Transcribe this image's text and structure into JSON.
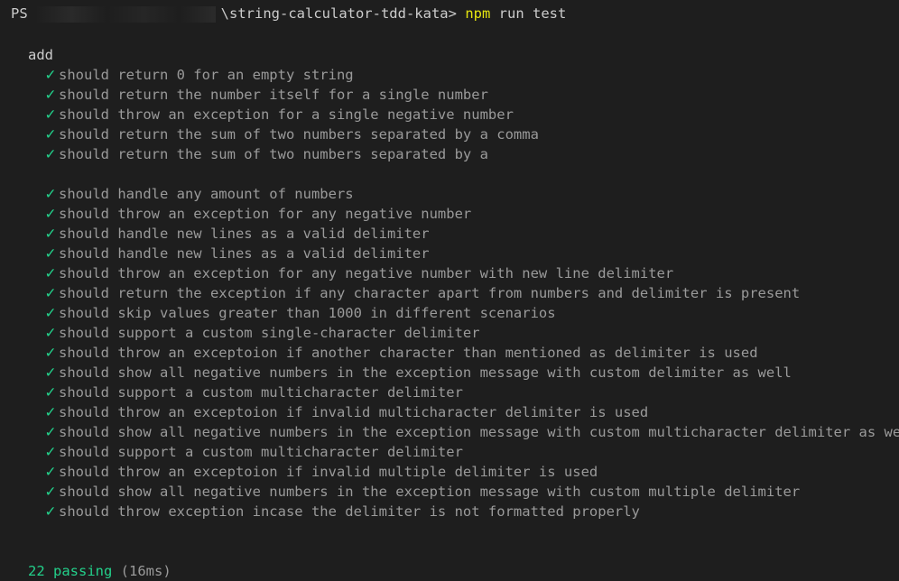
{
  "terminal": {
    "prompt": {
      "ps": "PS",
      "path": "\\string-calculator-tdd-kata>",
      "command": "npm",
      "args": "run test"
    },
    "suite": "add",
    "tests": [
      "should return 0 for an empty string",
      "should return the number itself for a single number",
      "should throw an exception for a single negative number",
      "should return the sum of two numbers separated by a comma",
      "should return the sum of two numbers separated by a\n",
      "should handle any amount of numbers",
      "should throw an exception for any negative number",
      "should handle new lines as a valid delimiter",
      "should handle new lines as a valid delimiter",
      "should throw an exception for any negative number with new line delimiter",
      "should return the exception if any character apart from numbers and delimiter is present",
      "should skip values greater than 1000 in different scenarios",
      "should support a custom single-character delimiter",
      "should throw an exceptoion if another character than mentioned as delimiter is used",
      "should show all negative numbers in the exception message with custom delimiter as well",
      "should support a custom multicharacter delimiter",
      "should throw an exceptoion if invalid multicharacter delimiter is used",
      "should show all negative numbers in the exception message with custom multicharacter delimiter as well",
      "should support a custom multicharacter delimiter",
      "should throw an exceptoion if invalid multiple delimiter is used",
      "should show all negative numbers in the exception message with custom multiple delimiter",
      "should throw exception incase the delimiter is not formatted properly"
    ],
    "check_icon": "check-icon",
    "summary": {
      "passing": "22 passing",
      "duration": "(16ms)"
    },
    "colors": {
      "background": "#1e1e1e",
      "pass": "#23d18b",
      "command": "#e5e510",
      "muted": "#9a9a9a"
    }
  }
}
